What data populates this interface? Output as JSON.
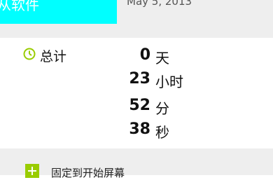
{
  "app": {
    "tile_label": "从软件",
    "date": "May 5, 2013",
    "accent_color": "#00ffff",
    "icon_color": "#99cc00"
  },
  "stats": {
    "section_label": "总计",
    "section_icon": "clock-icon",
    "rows": [
      {
        "value": "0",
        "unit": "天"
      },
      {
        "value": "23",
        "unit": "小时"
      },
      {
        "value": "52",
        "unit": "分"
      },
      {
        "value": "38",
        "unit": "秒"
      }
    ]
  },
  "pin": {
    "label": "固定到开始屏幕",
    "icon": "plus-icon"
  }
}
